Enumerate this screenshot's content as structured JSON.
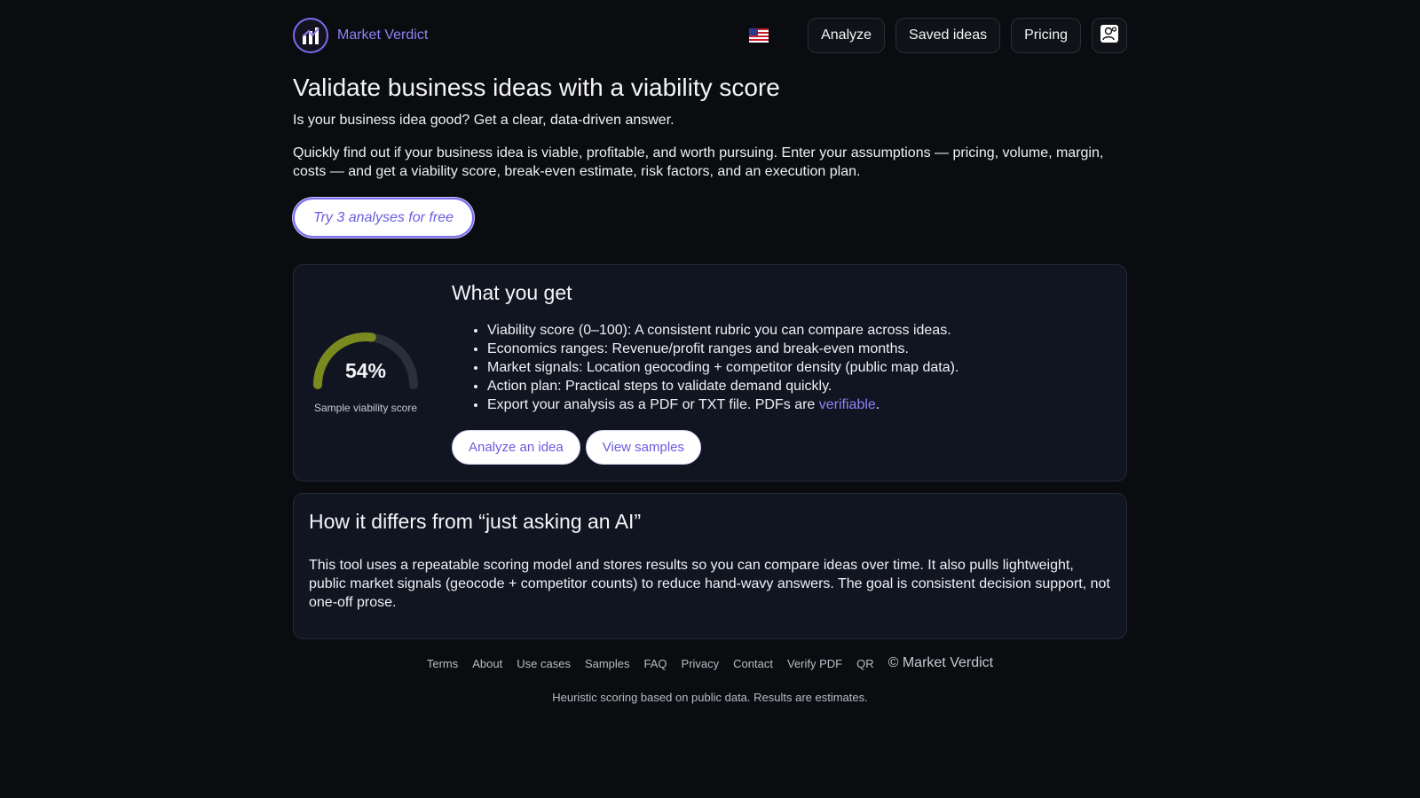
{
  "brand": {
    "name": "Market Verdict"
  },
  "nav": {
    "locale_flag": "us-flag",
    "analyze": "Analyze",
    "saved_ideas": "Saved ideas",
    "pricing": "Pricing",
    "account_icon": "user-icon"
  },
  "hero": {
    "title": "Validate business ideas with a viability score",
    "tagline": "Is your business idea good? Get a clear, data-driven answer.",
    "intro": "Quickly find out if your business idea is viable, profitable, and worth pursuing. Enter your assumptions — pricing, volume, margin, costs — and get a viability score, break-even estimate, risk factors, and an execution plan.",
    "cta": "Try 3 analyses for free"
  },
  "features_card": {
    "gauge_value": 54,
    "gauge_label": "54%",
    "gauge_caption": "Sample viability score",
    "title": "What you get",
    "items": [
      "Viability score (0–100): A consistent rubric you can compare across ideas.",
      "Economics ranges: Revenue/profit ranges and break-even months.",
      "Market signals: Location geocoding + competitor density (public map data).",
      "Action plan: Practical steps to validate demand quickly."
    ],
    "export_prefix": "Export your analysis as a PDF or TXT file. PDFs are ",
    "export_link": "verifiable",
    "export_suffix": ".",
    "analyze_button": "Analyze an idea",
    "samples_button": "View samples"
  },
  "diff_card": {
    "title": "How it differs from “just asking an AI”",
    "body": "This tool uses a repeatable scoring model and stores results so you can compare ideas over time. It also pulls lightweight, public market signals (geocode + competitor counts) to reduce hand-wavy answers. The goal is consistent decision support, not one-off prose."
  },
  "footer": {
    "links": [
      "Terms",
      "About",
      "Use cases",
      "Samples",
      "FAQ",
      "Privacy",
      "Contact",
      "Verify PDF",
      "QR"
    ],
    "copyright": "© Market Verdict",
    "note": "Heuristic scoring based on public data. Results are estimates."
  },
  "colors": {
    "background": "#0b0c10",
    "card": "#111522",
    "accent": "#7a6cf0",
    "gauge_fill": "#7a8a1e",
    "gauge_track": "#2a2f3a"
  }
}
